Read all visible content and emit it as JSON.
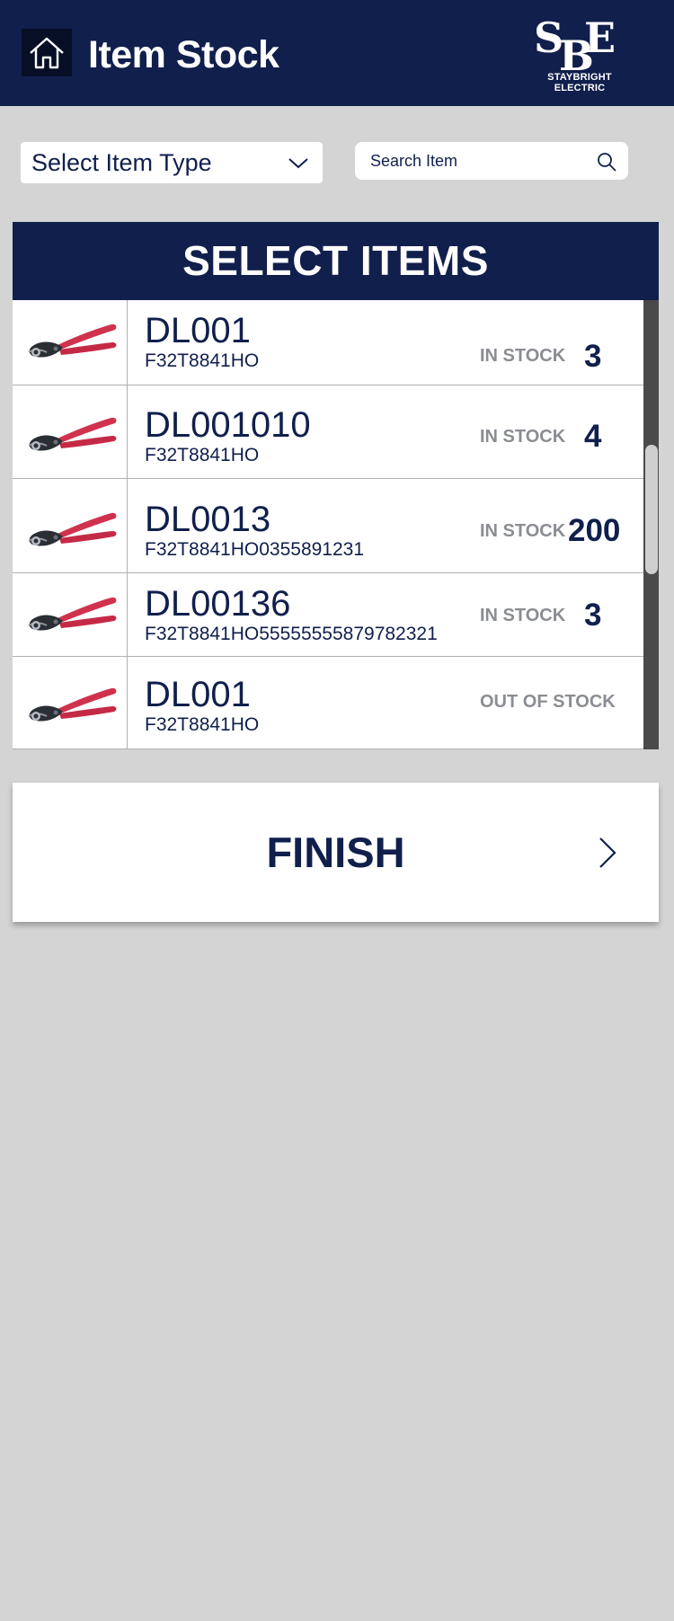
{
  "header": {
    "title": "Item Stock",
    "home_icon": "home-icon",
    "logo": {
      "mark": "SBE",
      "text": "STAYBRIGHT ELECTRIC"
    }
  },
  "filters": {
    "item_type": {
      "value": "Select Item Type",
      "icon": "chevron-down-icon"
    },
    "search": {
      "placeholder": "Search Item",
      "value": "",
      "icon": "search-icon"
    }
  },
  "panel": {
    "title": "SELECT ITEMS",
    "items": [
      {
        "code": "DL001",
        "part": "F32T8841HO",
        "status": "IN STOCK",
        "qty": "3",
        "image_icon": "wire-cutter-icon"
      },
      {
        "code": "DL001010",
        "part": "F32T8841HO",
        "status": "IN STOCK",
        "qty": "4",
        "image_icon": "wire-cutter-icon"
      },
      {
        "code": "DL0013",
        "part": "F32T8841HO0355891231",
        "status": "IN STOCK",
        "qty": "200",
        "image_icon": "wire-cutter-icon"
      },
      {
        "code": "DL00136",
        "part": "F32T8841HO55555555879782321",
        "status": "IN STOCK",
        "qty": "3",
        "image_icon": "wire-cutter-icon"
      },
      {
        "code": "DL001",
        "part": "F32T8841HO",
        "status": "OUT OF STOCK",
        "qty": "",
        "image_icon": "wire-cutter-icon"
      }
    ]
  },
  "finish": {
    "label": "FINISH",
    "icon": "chevron-right-icon"
  },
  "colors": {
    "navy": "#101f4c",
    "background": "#d4d4d4",
    "muted": "#8a8d92",
    "handle": "#d0324e"
  }
}
